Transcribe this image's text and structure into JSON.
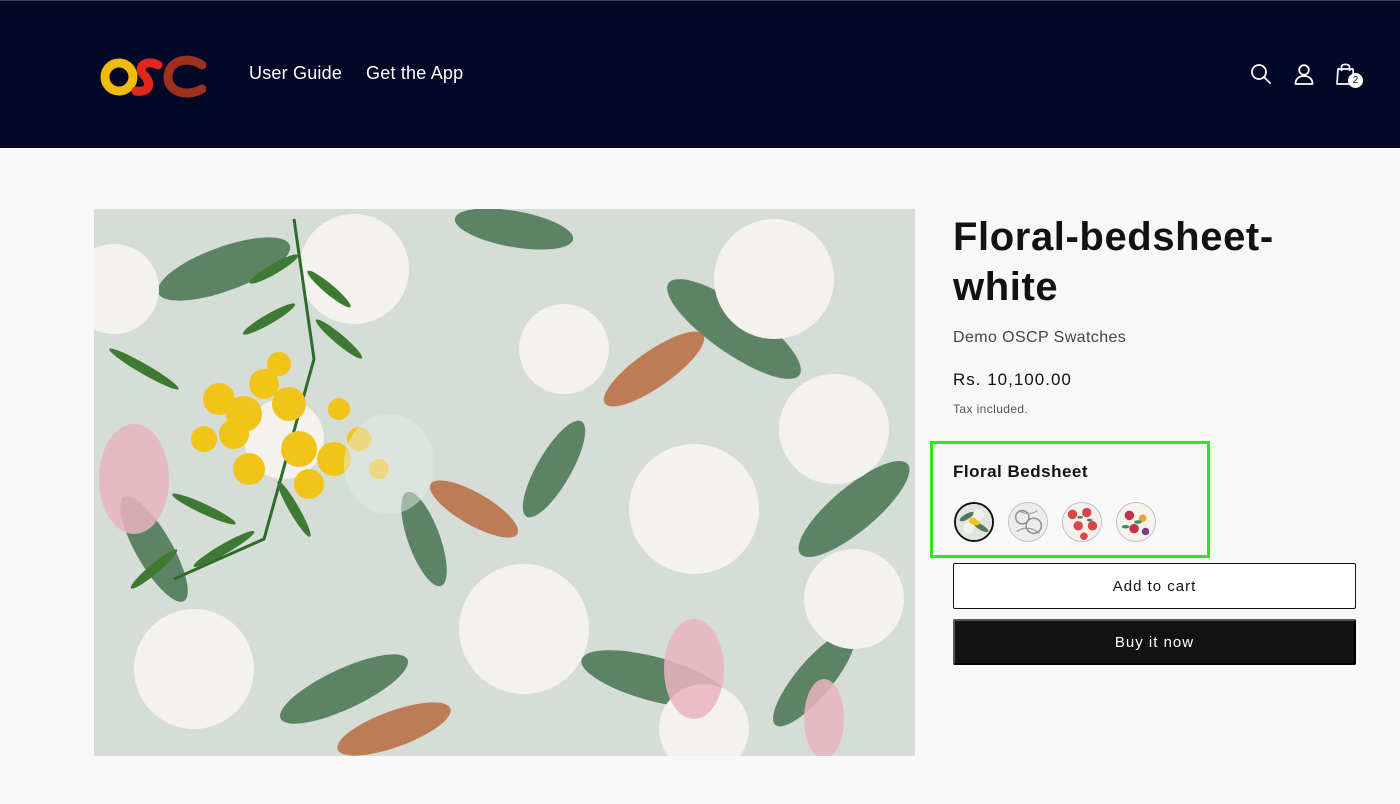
{
  "header": {
    "logo_text": "OSC",
    "nav": [
      {
        "label": "User Guide"
      },
      {
        "label": "Get the App"
      }
    ],
    "icons": [
      "search-icon",
      "account-icon",
      "cart-icon"
    ],
    "cart_count": "2",
    "background_color": "#020826"
  },
  "product": {
    "title": "Floral-bedsheet-white",
    "vendor": "Demo OSCP Swatches",
    "price": "Rs. 10,100.00",
    "tax_note": "Tax included.",
    "image_description": "floral-bedsheet-white-image"
  },
  "swatches": {
    "label": "Floral Bedsheet",
    "highlight_color": "#2ee91a",
    "options": [
      {
        "name": "floral-white",
        "selected": true
      },
      {
        "name": "floral-grey",
        "selected": false
      },
      {
        "name": "floral-red",
        "selected": false
      },
      {
        "name": "floral-multicolor",
        "selected": false
      }
    ]
  },
  "actions": {
    "add_to_cart_label": "Add to cart",
    "buy_now_label": "Buy it now"
  }
}
